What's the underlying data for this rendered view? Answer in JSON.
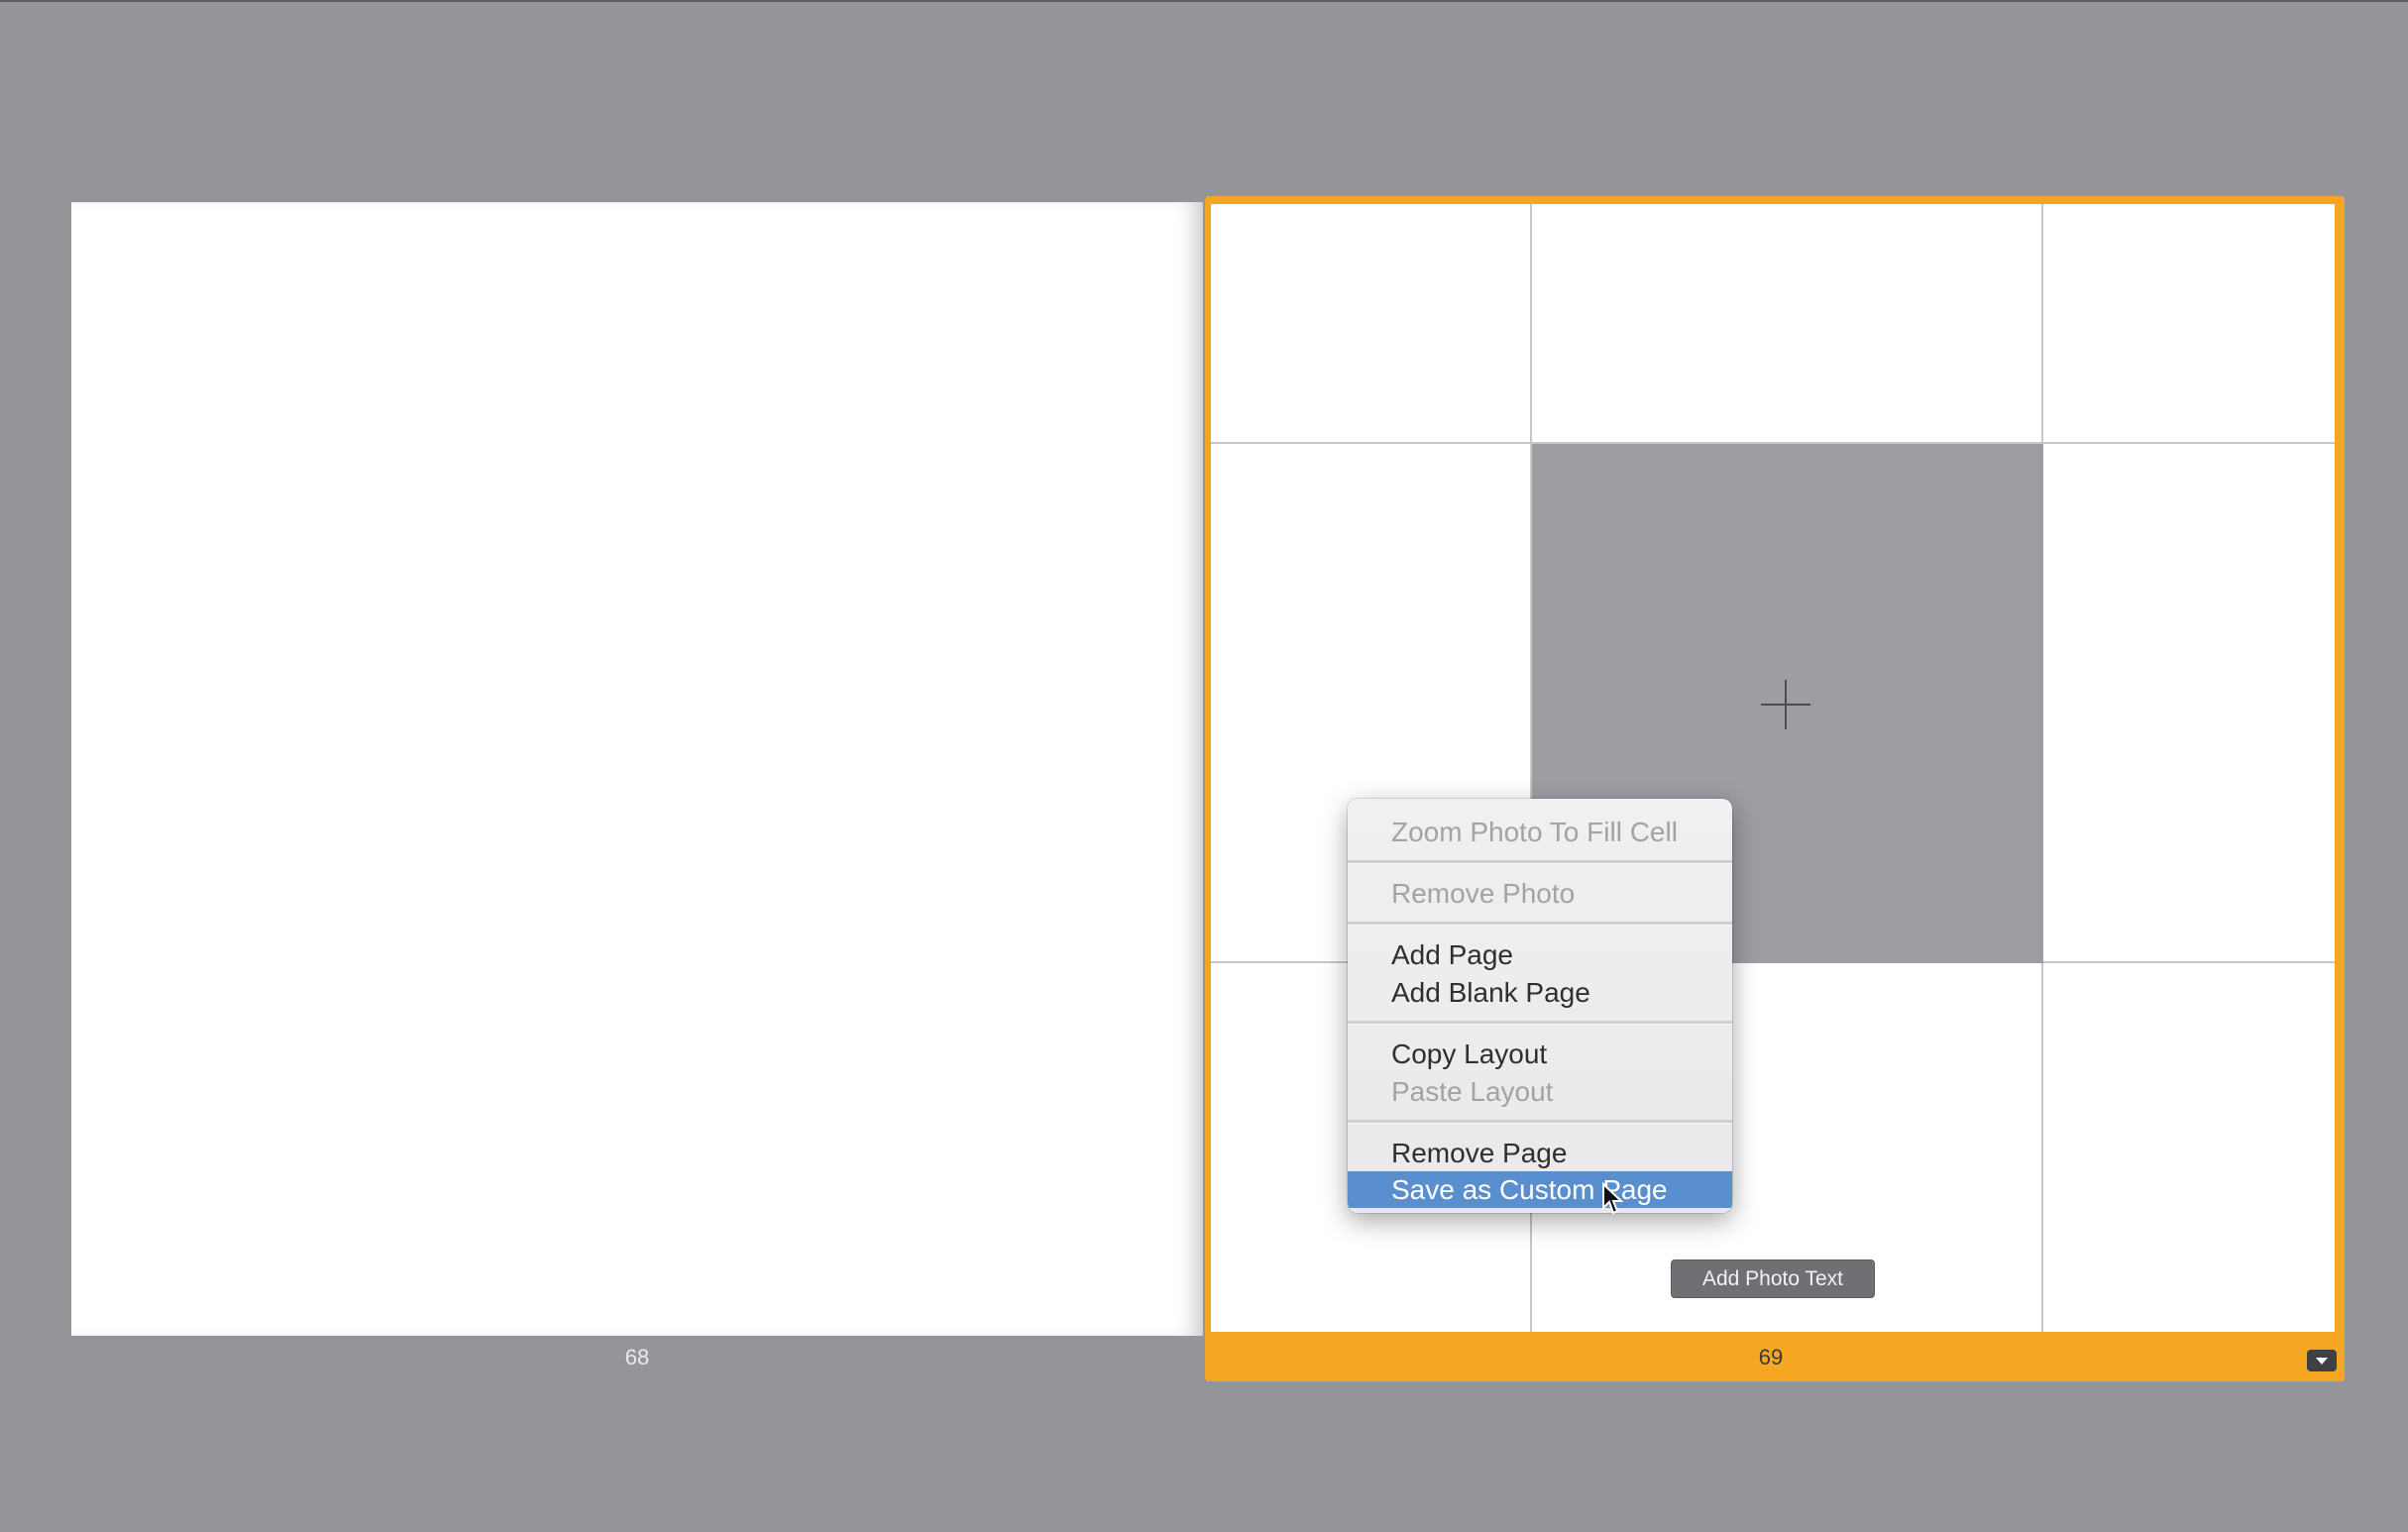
{
  "pages": [
    {
      "number_label": "68",
      "selected": false
    },
    {
      "number_label": "69",
      "selected": true
    }
  ],
  "right_page": {
    "photo_cell": {
      "state": "empty",
      "icon": "plus-icon"
    },
    "add_photo_text_label": "Add Photo Text",
    "page_menu_icon": "triangle-down-icon"
  },
  "context_menu": {
    "items": [
      {
        "label": "Zoom Photo To Fill Cell",
        "enabled": false
      },
      {
        "label": "Remove Photo",
        "enabled": false
      },
      {
        "label": "Add Page",
        "enabled": true
      },
      {
        "label": "Add Blank Page",
        "enabled": true
      },
      {
        "label": "Copy Layout",
        "enabled": true
      },
      {
        "label": "Paste Layout",
        "enabled": false
      },
      {
        "label": "Remove Page",
        "enabled": true
      },
      {
        "label": "Save as Custom Page",
        "enabled": true,
        "highlighted": true
      }
    ]
  },
  "colors": {
    "background": "#939599",
    "selection_accent": "#f5a623",
    "menu_highlight": "#5a8fcf",
    "photo_placeholder": "#9c9ea2"
  }
}
